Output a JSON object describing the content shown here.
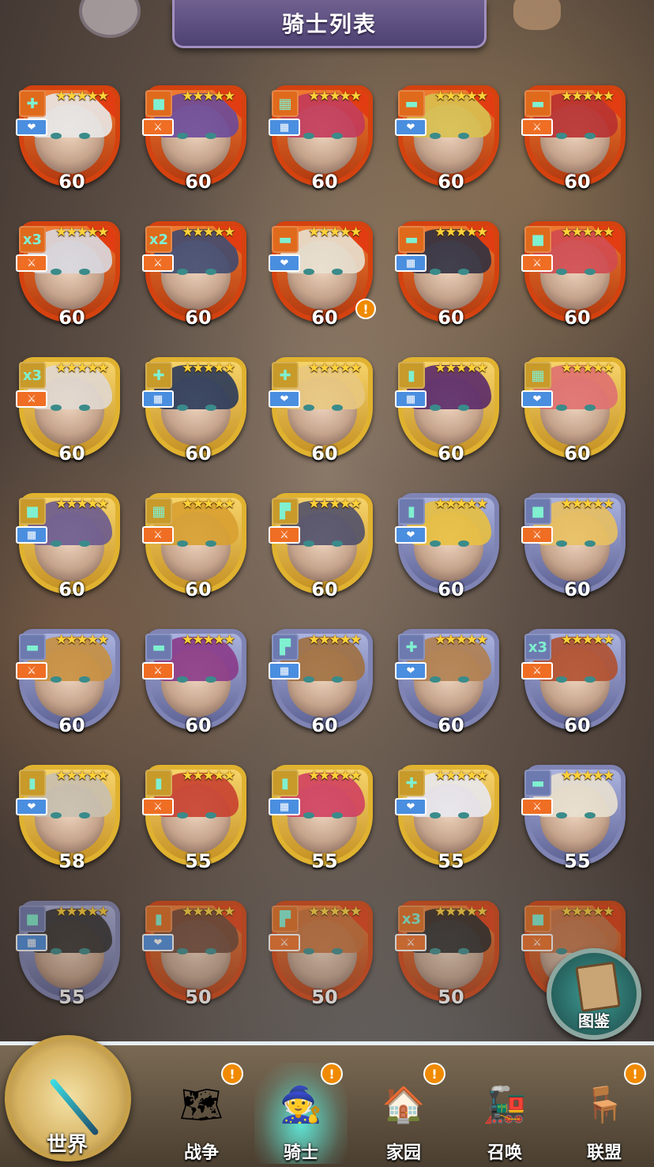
{
  "header": {
    "title": "骑士列表"
  },
  "knights": [
    {
      "level": "60",
      "frame": "red",
      "shape": "✚",
      "role": "heal",
      "hair": "#e8e8e8"
    },
    {
      "level": "60",
      "frame": "red",
      "shape": "■",
      "role": "attack",
      "hair": "#6b4a9a"
    },
    {
      "level": "60",
      "frame": "red",
      "shape": "▦",
      "role": "defense",
      "hair": "#c23a5a"
    },
    {
      "level": "60",
      "frame": "red",
      "shape": "▬",
      "role": "heal",
      "hair": "#d8c050"
    },
    {
      "level": "60",
      "frame": "red",
      "shape": "▬",
      "role": "attack",
      "hair": "#b83030"
    },
    {
      "level": "60",
      "frame": "red",
      "shape": "x3",
      "role": "attack",
      "hair": "#d8d8e0"
    },
    {
      "level": "60",
      "frame": "red",
      "shape": "x2",
      "role": "attack",
      "hair": "#404a70"
    },
    {
      "level": "60",
      "frame": "red",
      "shape": "▬",
      "role": "heal",
      "hair": "#e8e0d0",
      "alert": "!"
    },
    {
      "level": "60",
      "frame": "red",
      "shape": "▬",
      "role": "defense",
      "hair": "#303040"
    },
    {
      "level": "60",
      "frame": "red",
      "shape": "■",
      "role": "attack",
      "hair": "#d04a50"
    },
    {
      "level": "60",
      "frame": "gold",
      "shape": "x3",
      "role": "attack",
      "hair": "#e0d8d0"
    },
    {
      "level": "60",
      "frame": "gold",
      "shape": "✚",
      "role": "defense",
      "hair": "#2a3a5a"
    },
    {
      "level": "60",
      "frame": "gold",
      "shape": "✚",
      "role": "heal",
      "hair": "#e8c880"
    },
    {
      "level": "60",
      "frame": "gold",
      "shape": "▮",
      "role": "defense",
      "hair": "#5a2a6a"
    },
    {
      "level": "60",
      "frame": "gold",
      "shape": "▦",
      "role": "heal",
      "hair": "#e07070"
    },
    {
      "level": "60",
      "frame": "gold",
      "shape": "■",
      "role": "defense",
      "hair": "#6a5a90"
    },
    {
      "level": "60",
      "frame": "gold",
      "shape": "▦",
      "role": "attack",
      "hair": "#d8a030"
    },
    {
      "level": "60",
      "frame": "gold",
      "shape": "▛",
      "role": "attack",
      "hair": "#50506a"
    },
    {
      "level": "60",
      "frame": "blue",
      "shape": "▮",
      "role": "heal",
      "hair": "#e8c040"
    },
    {
      "level": "60",
      "frame": "blue",
      "shape": "■",
      "role": "attack",
      "hair": "#e8c060"
    },
    {
      "level": "60",
      "frame": "blue",
      "shape": "▬",
      "role": "attack",
      "hair": "#c89040"
    },
    {
      "level": "60",
      "frame": "blue",
      "shape": "▬",
      "role": "attack",
      "hair": "#8a3a8a"
    },
    {
      "level": "60",
      "frame": "blue",
      "shape": "▛",
      "role": "defense",
      "hair": "#a07040"
    },
    {
      "level": "60",
      "frame": "blue",
      "shape": "✚",
      "role": "heal",
      "hair": "#b08050"
    },
    {
      "level": "60",
      "frame": "blue",
      "shape": "x3",
      "role": "attack",
      "hair": "#b05030"
    },
    {
      "level": "58",
      "frame": "gold",
      "shape": "▮",
      "role": "heal",
      "hair": "#c8c0b0"
    },
    {
      "level": "55",
      "frame": "gold",
      "shape": "▮",
      "role": "attack",
      "hair": "#c84030"
    },
    {
      "level": "55",
      "frame": "gold",
      "shape": "▮",
      "role": "defense",
      "hair": "#d04060"
    },
    {
      "level": "55",
      "frame": "gold",
      "shape": "✚",
      "role": "heal",
      "hair": "#e8e8f0"
    },
    {
      "level": "55",
      "frame": "blue",
      "shape": "▬",
      "role": "attack",
      "hair": "#e8e0d0"
    },
    {
      "level": "55",
      "frame": "blue",
      "shape": "■",
      "role": "defense",
      "hair": "#2a2a2a",
      "dim": true
    },
    {
      "level": "50",
      "frame": "red",
      "shape": "▮",
      "role": "heal",
      "hair": "#6a4030",
      "dim": true
    },
    {
      "level": "50",
      "frame": "red",
      "shape": "▛",
      "role": "attack",
      "hair": "#c86a30",
      "dim": true
    },
    {
      "level": "50",
      "frame": "red",
      "shape": "x3",
      "role": "attack",
      "hair": "#202020",
      "dim": true
    },
    {
      "level": "",
      "frame": "red",
      "shape": "■",
      "role": "attack",
      "hair": "#c87040",
      "dim": true
    }
  ],
  "role_icons": {
    "heal": "❤",
    "attack": "⚔",
    "defense": "▦"
  },
  "stars": "★★★★★",
  "codex": {
    "label": "图鉴"
  },
  "nav": {
    "world": {
      "label": "世界"
    },
    "items": [
      {
        "label": "战争",
        "icon": "🗺",
        "badge": "!"
      },
      {
        "label": "骑士",
        "icon": "🧙",
        "badge": "!",
        "active": true
      },
      {
        "label": "家园",
        "icon": "🏠",
        "badge": "!"
      },
      {
        "label": "召唤",
        "icon": "🚂",
        "badge": ""
      },
      {
        "label": "联盟",
        "icon": "🪑",
        "badge": "!"
      }
    ]
  },
  "colors": {
    "red": "#d4420f",
    "gold": "#e0b230",
    "blue": "#7f84b4",
    "accent": "#f08a00"
  }
}
